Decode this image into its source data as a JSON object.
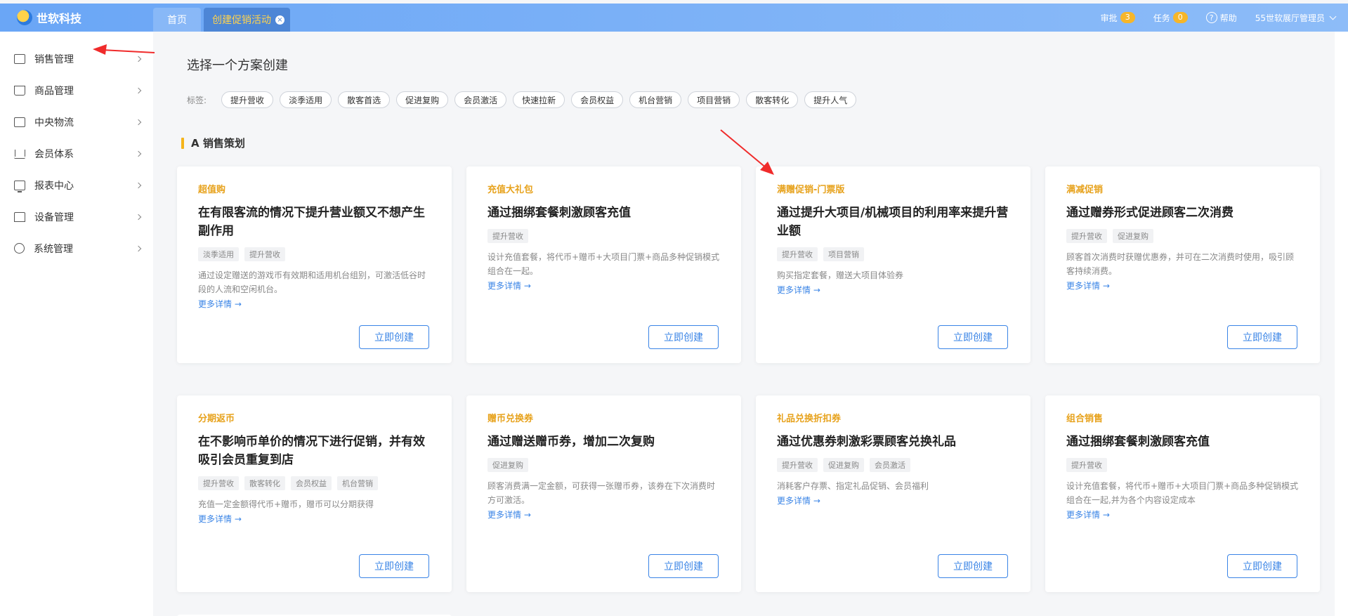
{
  "header": {
    "brand": "世软科技",
    "tabs": [
      {
        "label": "首页"
      },
      {
        "label": "创建促销活动",
        "close": "×"
      }
    ],
    "approve_label": "审批",
    "approve_count": "3",
    "task_label": "任务",
    "task_count": "0",
    "help_label": "帮助",
    "user": "55世软展厅管理员"
  },
  "sidebar": {
    "items": [
      {
        "label": "销售管理",
        "icon": "calendar-icon"
      },
      {
        "label": "商品管理",
        "icon": "bag-icon"
      },
      {
        "label": "中央物流",
        "icon": "cart-icon"
      },
      {
        "label": "会员体系",
        "icon": "crown-icon"
      },
      {
        "label": "报表中心",
        "icon": "screen-icon"
      },
      {
        "label": "设备管理",
        "icon": "home-icon"
      },
      {
        "label": "系统管理",
        "icon": "gear-icon"
      }
    ]
  },
  "main": {
    "page_title": "选择一个方案创建",
    "tag_label": "标签:",
    "tags": [
      "提升营收",
      "淡季适用",
      "散客首选",
      "促进复购",
      "会员激活",
      "快速拉新",
      "会员权益",
      "机台营销",
      "项目营销",
      "散客转化",
      "提升人气"
    ],
    "section_title": "A 销售策划",
    "cards": [
      {
        "kicker": "超值购",
        "title": "在有限客流的情况下提升营业额又不想产生副作用",
        "tags": [
          "淡季适用",
          "提升营收"
        ],
        "desc": "通过设定赠送的游戏币有效期和适用机台组别，可激活低谷时段的人流和空闲机台。",
        "more": "更多详情 →",
        "button": "立即创建"
      },
      {
        "kicker": "充值大礼包",
        "title": "通过捆绑套餐刺激顾客充值",
        "tags": [
          "提升营收"
        ],
        "desc": "设计充值套餐，将代币+赠币+大项目门票+商品多种促销模式组合在一起。",
        "more": "更多详情 →",
        "button": "立即创建"
      },
      {
        "kicker": "满赠促销-门票版",
        "title": "通过提升大项目/机械项目的利用率来提升营业额",
        "tags": [
          "提升营收",
          "项目营销"
        ],
        "desc": "购买指定套餐，赠送大项目体验券",
        "more": "更多详情 →",
        "button": "立即创建"
      },
      {
        "kicker": "满减促销",
        "title": "通过赠券形式促进顾客二次消费",
        "tags": [
          "提升营收",
          "促进复购"
        ],
        "desc": "顾客首次消费时获赠优惠券，并可在二次消费时使用，吸引顾客持续消费。",
        "more": "更多详情 →",
        "button": "立即创建"
      },
      {
        "kicker": "分期返币",
        "title": "在不影响币单价的情况下进行促销，并有效吸引会员重复到店",
        "tags": [
          "提升营收",
          "散客转化",
          "会员权益",
          "机台营销"
        ],
        "desc": "充值一定金额得代币+赠币，赠币可以分期获得",
        "more": "更多详情 →",
        "button": "立即创建"
      },
      {
        "kicker": "赠币兑换券",
        "title": "通过赠送赠币券，增加二次复购",
        "tags": [
          "促进复购"
        ],
        "desc": "顾客消费满一定金额，可获得一张赠币券，该券在下次消费时方可激活。",
        "more": "更多详情 →",
        "button": "立即创建"
      },
      {
        "kicker": "礼品兑换折扣券",
        "title": "通过优惠券刺激彩票顾客兑换礼品",
        "tags": [
          "提升营收",
          "促进复购",
          "会员激活"
        ],
        "desc": "消耗客户存票、指定礼品促销、会员福利",
        "more": "更多详情 →",
        "button": "立即创建"
      },
      {
        "kicker": "组合销售",
        "title": "通过捆绑套餐刺激顾客充值",
        "tags": [
          "提升营收"
        ],
        "desc": "设计充值套餐，将代币+赠币+大项目门票+商品多种促销模式组合在一起,并为各个内容设定成本",
        "more": "更多详情 →",
        "button": "立即创建"
      }
    ]
  },
  "colors": {
    "header_start": "#6aa6f6",
    "header_end": "#8dbcf8",
    "accent_blue": "#3a84e6",
    "kicker_orange": "#e7a21c",
    "badge_orange": "#f6b62a",
    "annotation_red": "#f02b2b"
  }
}
